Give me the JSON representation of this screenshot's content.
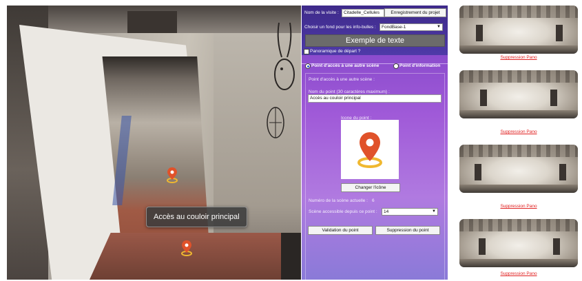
{
  "viewer": {
    "hotspot_label": "Accès au couloir principal"
  },
  "panel": {
    "visit_name_label": "Nom de la visite :",
    "visit_name_value": "Citadelle_Cellules",
    "save_project_label": "Enregistrement du projet",
    "bg_label": "Choisir un fond pour les info-bulles :",
    "bg_selected": "FondBase-1",
    "sample_text": "Exemple de texte",
    "start_pano_label": "Panoramique de départ ?",
    "radio_scene_label": "Point d'accès à une autre scène",
    "radio_info_label": "Point d'information",
    "section_title": "Point d'accès à une autre scène :",
    "point_name_label": "Nom du point (30 caractères maximum) :",
    "point_name_value": "Accès au couloir principal",
    "icon_label": "Icone du point :",
    "change_icon_label": "Changer l'icône",
    "scene_number_label": "Numéro de la scène actuelle :",
    "scene_number_value": "6",
    "accessible_scene_label": "Scène accessible depuis ce point :",
    "accessible_scene_value": "14",
    "validate_label": "Validation du point",
    "delete_point_label": "Suppression du point"
  },
  "thumbnails": [
    {
      "link": "Suppression Pano"
    },
    {
      "link": "Suppression Pano"
    },
    {
      "link": "Suppression Pano"
    },
    {
      "link": "Suppression Pano"
    }
  ],
  "colors": {
    "panel_top": "#3e2a8a",
    "panel_body": "#a05ad8",
    "pin_orange": "#e0522a",
    "pin_ring": "#f0b830",
    "delete_link": "#e02020"
  }
}
